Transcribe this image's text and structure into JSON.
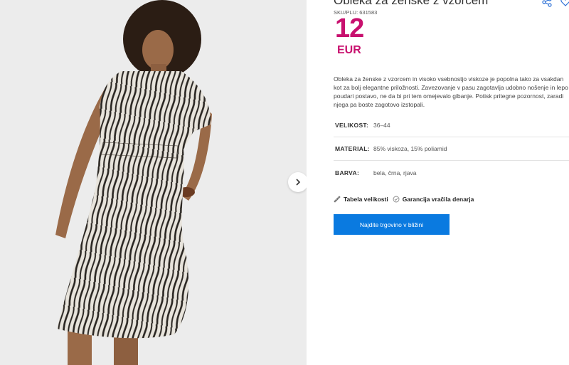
{
  "product": {
    "title": "Obleka za ženske z vzorcem",
    "sku": "SKU/PLU: 631583",
    "price": "12",
    "currency": "EUR",
    "description": "Obleka za ženske z vzorcem in visoko vsebnostjo viskoze je popolna tako za vsakdan kot za bolj elegantne priložnosti. Zavezovanje v pasu zagotavlja udobno nošenje in lepo poudari postavo, ne da bi pri tem omejevalo gibanje. Potisk pritegne pozornost, zaradi njega pa boste zagotovo izstopali."
  },
  "attributes": [
    {
      "label": "VELIKOST:",
      "value": "36–44"
    },
    {
      "label": "MATERIAL:",
      "value": "85% viskoza, 15% poliamid"
    },
    {
      "label": "BARVA:",
      "value": "bela, črna, rjava"
    }
  ],
  "links": {
    "size_table": "Tabela velikosti",
    "guarantee": "Garancija vračila denarja"
  },
  "cta": {
    "label": "Najdite trgovino v bližini"
  },
  "colors": {
    "price": "#c8106e",
    "cta": "#0a7ae0",
    "image_bg": "#ececec"
  },
  "icons": {
    "share": "share-icon",
    "favorite": "heart-icon",
    "next": "chevron-right-icon",
    "ruler": "ruler-icon",
    "guarantee": "shield-icon"
  }
}
